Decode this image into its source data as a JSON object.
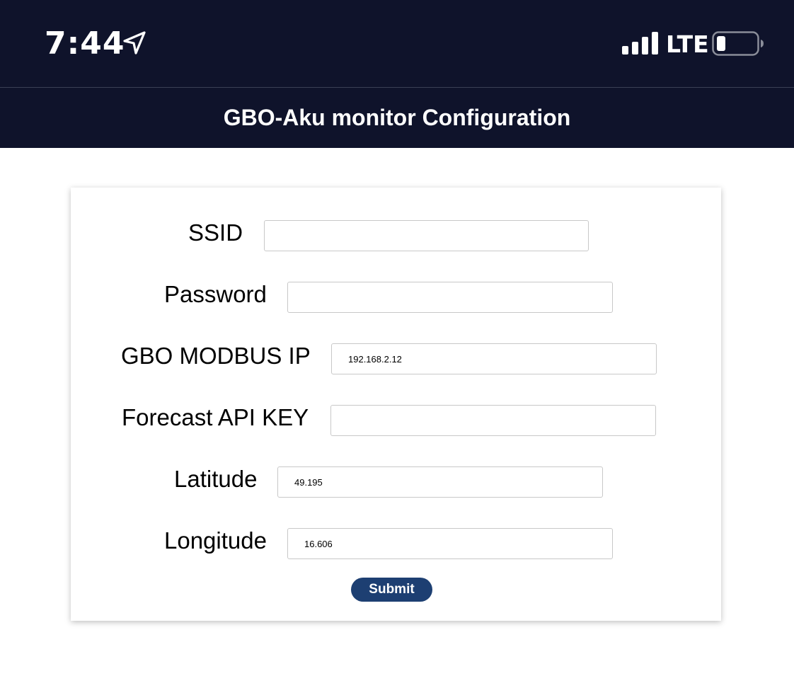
{
  "status_bar": {
    "time": "7:44",
    "network": "LTE"
  },
  "header": {
    "title": "GBO-Aku monitor Configuration"
  },
  "form": {
    "fields": [
      {
        "label": "SSID",
        "value": ""
      },
      {
        "label": "Password",
        "value": ""
      },
      {
        "label": "GBO MODBUS IP",
        "value": "192.168.2.12"
      },
      {
        "label": "Forecast API KEY",
        "value": ""
      },
      {
        "label": "Latitude",
        "value": "49.195"
      },
      {
        "label": "Longitude",
        "value": "16.606"
      }
    ],
    "submit_label": "Submit"
  },
  "icons": {
    "location": "location-arrow-icon",
    "signal": "cellular-signal-icon",
    "battery": "battery-low-icon"
  },
  "colors": {
    "status_bar_bg": "#0f132b",
    "button_bg": "#1d3f72",
    "text_on_dark": "#ffffff"
  }
}
